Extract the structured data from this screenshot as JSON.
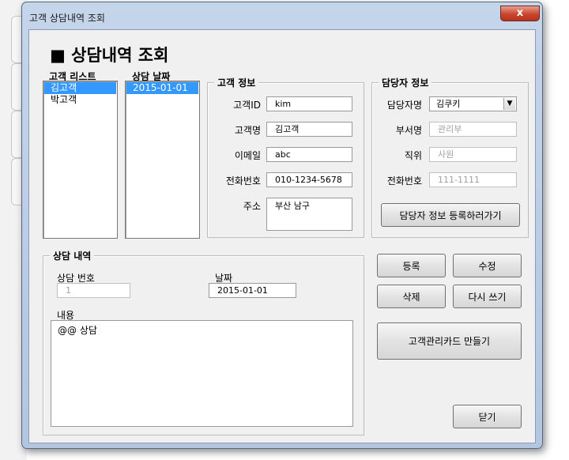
{
  "window": {
    "title": "고객 상담내역 조회",
    "close_label": "x"
  },
  "heading": "■ 상담내역 조회",
  "client_list": {
    "label": "고객 리스트",
    "items": [
      "김고객",
      "박고객"
    ],
    "selected": 0
  },
  "date_list": {
    "label": "상담 날짜",
    "items": [
      "2015-01-01"
    ],
    "selected": 0
  },
  "customer_info": {
    "title": "고객 정보",
    "id_label": "고객ID",
    "id_value": "kim",
    "name_label": "고객명",
    "name_value": "김고객",
    "email_label": "이메일",
    "email_value": "abc",
    "phone_label": "전화번호",
    "phone_value": "010-1234-5678",
    "address_label": "주소",
    "address_value": "부산 남구"
  },
  "staff_info": {
    "title": "담당자 정보",
    "name_label": "담당자명",
    "name_value": "김쿠키",
    "dept_label": "부서명",
    "dept_value": "관리부",
    "position_label": "직위",
    "position_value": "사원",
    "phone_label": "전화번호",
    "phone_value": "111-1111",
    "register_button": "담당자 정보 등록하러가기"
  },
  "consult": {
    "title": "상담 내역",
    "number_label": "상담 번호",
    "number_value": "1",
    "date_label": "날짜",
    "date_value": "2015-01-01",
    "content_label": "내용",
    "content_value": "@@ 상담"
  },
  "buttons": {
    "register": "등록",
    "modify": "수정",
    "delete": "삭제",
    "rewrite": "다시 쓰기",
    "make_card": "고객관리카드 만들기",
    "close": "닫기"
  }
}
